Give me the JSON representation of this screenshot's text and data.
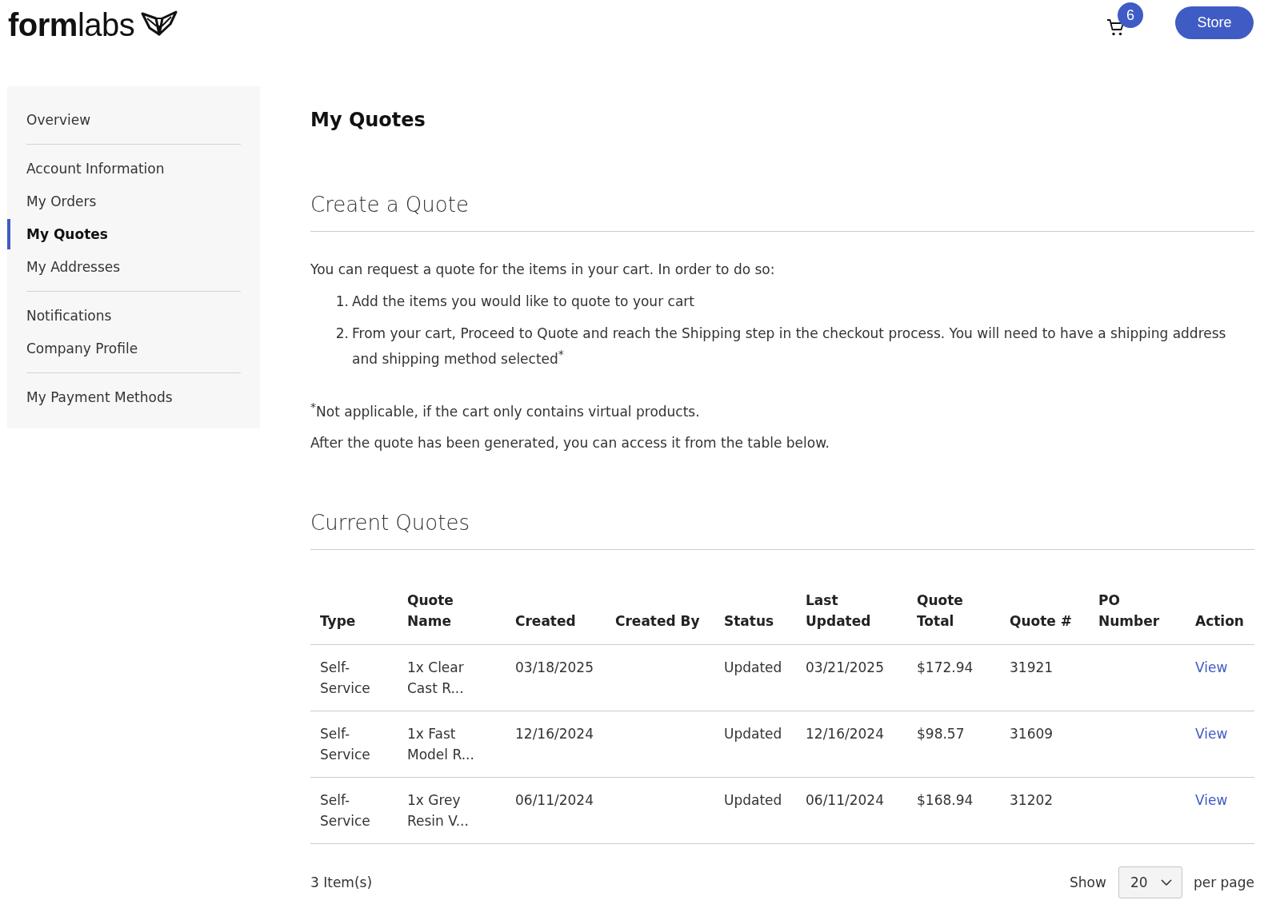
{
  "header": {
    "logo": "**form**labs",
    "cart_count": "6",
    "store_button": "Store"
  },
  "sidebar": {
    "sections": [
      {
        "items": [
          {
            "label": "Overview",
            "selected": false
          }
        ]
      },
      {
        "items": [
          {
            "label": "Account Information",
            "selected": false
          },
          {
            "label": "My Orders",
            "selected": false
          },
          {
            "label": "My Quotes",
            "selected": true
          },
          {
            "label": "My Addresses",
            "selected": false
          }
        ]
      },
      {
        "items": [
          {
            "label": "Notifications",
            "selected": false
          },
          {
            "label": "Company Profile",
            "selected": false
          }
        ]
      },
      {
        "items": [
          {
            "label": "My Payment Methods",
            "selected": false
          }
        ]
      }
    ]
  },
  "page_title": "My Quotes",
  "create_quote": {
    "heading": "Create a Quote",
    "intro": "You can request a quote for the items in your cart. In order to do so:",
    "steps": [
      {
        "number": "1.",
        "text": "Add the items you would like to quote to your cart"
      },
      {
        "number": "2.",
        "text": "From your cart, Proceed to Quote and reach the Shipping step in the checkout process. You will need to have a shipping address and shipping method selected$^{*}$"
      }
    ],
    "footnote": "$^{*}$Not applicable, if the cart only contains virtual products.",
    "note": "After the quote has been generated, you can access it from the table below."
  },
  "current_quotes": {
    "heading": "Current Quotes",
    "table": {
      "columns": [
        "Type",
        "Quote Name",
        "Created",
        "Created By",
        "Status",
        "Last Updated",
        "Quote Total",
        "Quote #",
        "PO Number",
        "Action"
      ],
      "rows": [
        {
          "type": "Self-Service",
          "quote_name": "1x Clear Cast R...",
          "created": "03/18/2025",
          "status": "Updated",
          "last_updated": "03/21/2025",
          "quote_total": "$172.94",
          "quote_number": "31921",
          "action": "View"
        },
        {
          "type": "Self-Service",
          "quote_name": "1x Fast Model R...",
          "created": "12/16/2024",
          "status": "Updated",
          "last_updated": "12/16/2024",
          "quote_total": "$98.57",
          "quote_number": "31609",
          "action": "View"
        },
        {
          "type": "Self-Service",
          "quote_name": "1x Grey Resin V...",
          "created": "06/11/2024",
          "status": "Updated",
          "last_updated": "06/11/2024",
          "quote_total": "$168.94",
          "quote_number": "31202",
          "action": "View"
        }
      ]
    },
    "footer": {
      "item_count": "3 Item(s)",
      "show_label": "Show",
      "per_page": "20",
      "per_page_label": "per page"
    }
  }
}
